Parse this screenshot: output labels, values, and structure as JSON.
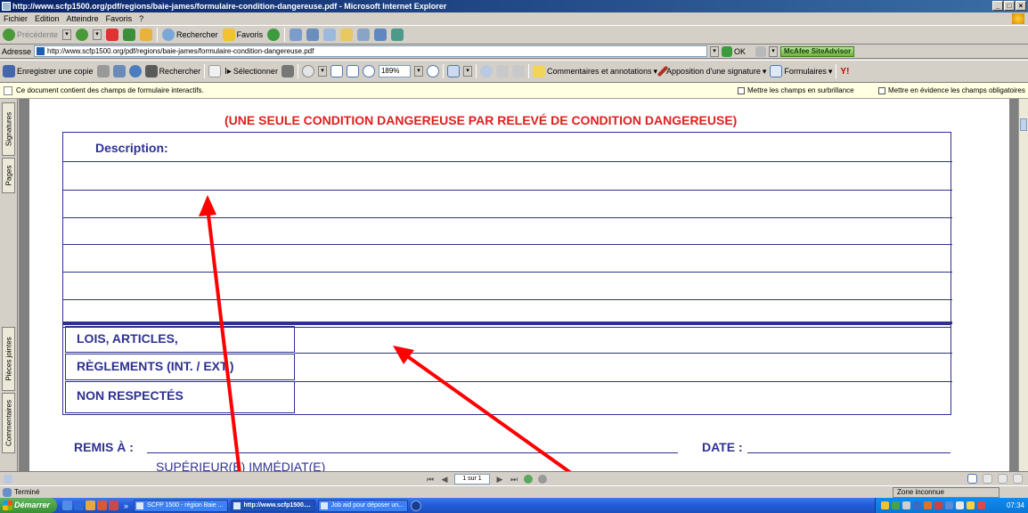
{
  "window": {
    "title": "http://www.scfp1500.org/pdf/regions/baie-james/formulaire-condition-dangereuse.pdf - Microsoft Internet Explorer",
    "controls": [
      "_",
      "□",
      "×"
    ]
  },
  "menu": [
    "Fichier",
    "Edition",
    "Atteindre",
    "Favoris",
    "?"
  ],
  "nav_toolbar": {
    "back": "Précédente",
    "search": "Rechercher",
    "favorites": "Favoris"
  },
  "address": {
    "label": "Adresse",
    "url": "http://www.scfp1500.org/pdf/regions/baie-james/formulaire-condition-dangereuse.pdf",
    "go": "OK",
    "mcafee": "McAfee SiteAdvisor"
  },
  "pdf_toolbar": {
    "save_copy": "Enregistrer une copie",
    "search": "Rechercher",
    "select": "Sélectionner",
    "zoom": "189%",
    "comments": "Commentaires et annotations",
    "signature": "Apposition d'une signature",
    "forms": "Formulaires"
  },
  "infobar": {
    "message": "Ce document contient des champs de formulaire interactifs.",
    "highlight_fields": "Mettre les champs en surbrillance",
    "highlight_required": "Mettre en évidence les champs obligatoires"
  },
  "side_tabs": {
    "signatures": "Signatures",
    "pages": "Pages",
    "attachments": "Pièces jointes",
    "comments": "Commentaires"
  },
  "form": {
    "heading": "(UNE SEULE CONDITION DANGEREUSE PAR RELEVÉ DE CONDITION DANGEREUSE)",
    "description_label": "Description:",
    "laws_line1": "LOIS, ARTICLES,",
    "laws_line2": "RÈGLEMENTS (INT. / EXT.)",
    "laws_line3": "NON RESPECTÉS",
    "remis_label": "REMIS À :",
    "superieur_label": "SUPÉRIEUR(E) IMMÉDIAT(E)",
    "date_label": "DATE :"
  },
  "pdf_status": {
    "page": "1 sur 1"
  },
  "ie_status": {
    "text": "Terminé",
    "zone": "Zone inconnue"
  },
  "taskbar": {
    "start": "Démarrer",
    "tasks": [
      "SCFP 1500 - région Baie ...",
      "http://www.scfp1500....",
      "Job aid pour déposer un..."
    ],
    "overflow": "»",
    "clock": "07:34"
  },
  "colors": {
    "form_blue": "#2e3192",
    "heading_red": "#e02020",
    "arrow_red": "#ff0000"
  }
}
